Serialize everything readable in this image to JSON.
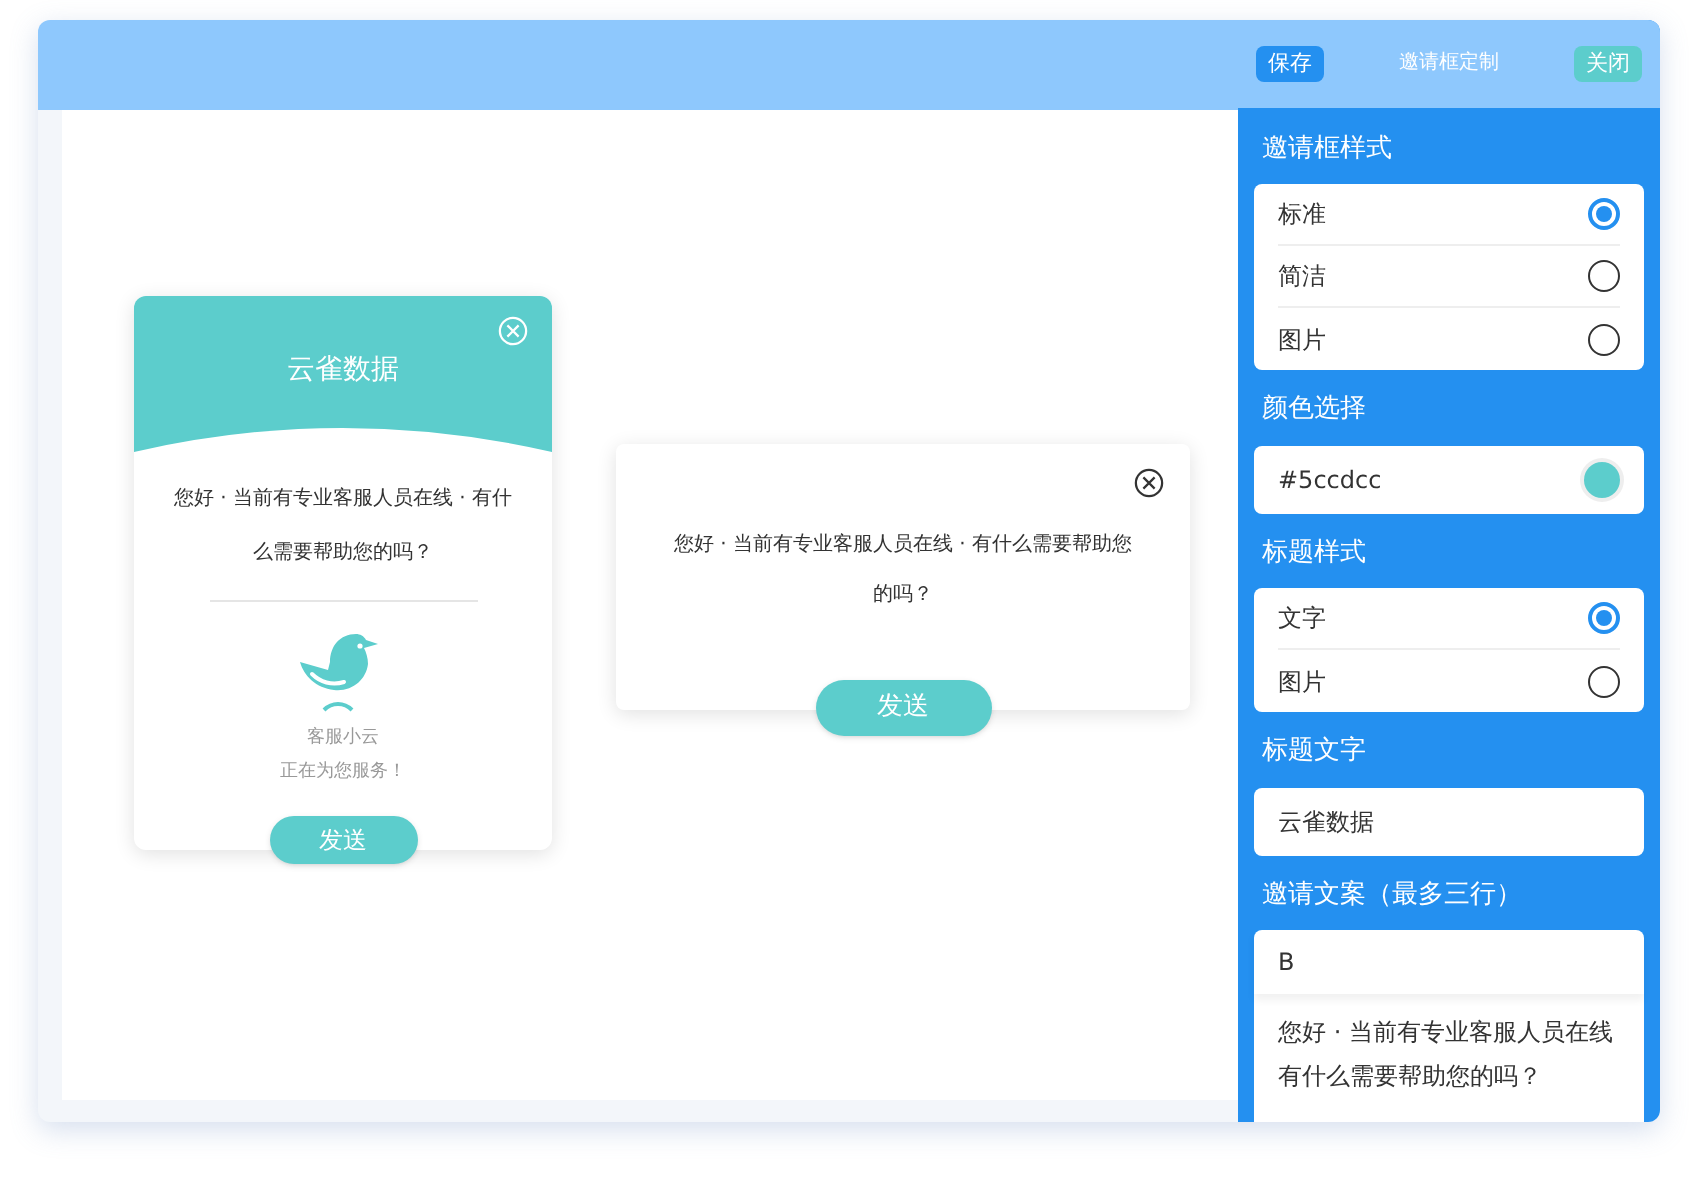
{
  "header": {
    "save": "保存",
    "title": "邀请框定制",
    "close": "关闭"
  },
  "preview": {
    "standard": {
      "title": "云雀数据",
      "message": "您好 · 当前有专业客服人员在线 · 有什么需要帮助您的吗？",
      "agent_name": "客服小云",
      "agent_status": "正在为您服务！",
      "button": "发送"
    },
    "simple": {
      "message": "您好 · 当前有专业客服人员在线 · 有什么需要帮助您的吗？",
      "button": "发送"
    }
  },
  "settings": {
    "sections": [
      {
        "kind": "radio",
        "label": "邀请框样式",
        "options": [
          {
            "label": "标准",
            "selected": true
          },
          {
            "label": "简洁",
            "selected": false
          },
          {
            "label": "图片",
            "selected": false
          }
        ]
      },
      {
        "kind": "color",
        "label": "颜色选择",
        "value": "#5ccdcc",
        "color": "#5ccdcc"
      },
      {
        "kind": "radio",
        "label": "标题样式",
        "options": [
          {
            "label": "文字",
            "selected": true
          },
          {
            "label": "图片",
            "selected": false
          }
        ]
      },
      {
        "kind": "text",
        "label": "标题文字",
        "value": "云雀数据"
      },
      {
        "kind": "rich",
        "label": "邀请文案（最多三行）",
        "toolbar": "B",
        "lines": [
          "您好 · 当前有专业客服人员在线",
          "有什么需要帮助您的吗？"
        ]
      }
    ]
  }
}
